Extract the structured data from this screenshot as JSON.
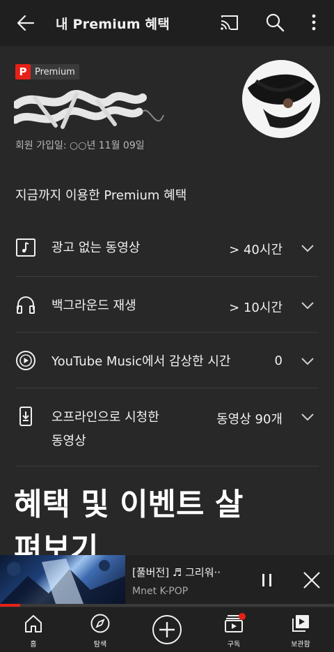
{
  "header": {
    "title": "내 Premium 혜택"
  },
  "membership": {
    "badge_letter": "P",
    "badge_label": "Premium",
    "joined_text": "회원 가입일: ○○년 11월 09일"
  },
  "benefits": {
    "section_title": "지금까지 이용한 Premium 혜택",
    "items": [
      {
        "label": "광고 없는 동영상",
        "value": "> 40시간",
        "icon": "music-note-icon"
      },
      {
        "label": "백그라운드 재생",
        "value": "> 10시간",
        "icon": "headphones-icon"
      },
      {
        "label": "YouTube Music에서 감상한 시간",
        "value": "0",
        "icon": "music-play-circle-icon"
      },
      {
        "label": "오프라인으로 시청한\n동영상",
        "value": "동영상 90개",
        "icon": "phone-download-icon"
      }
    ]
  },
  "events": {
    "title": "혜택 및 이벤트 살펴보기"
  },
  "miniplayer": {
    "title": "[풀버전] ♬ 그리워··",
    "subtitle": "Mnet K-POP",
    "progress_percent": 6
  },
  "bottom_nav": [
    {
      "label": "홈",
      "icon": "home-icon"
    },
    {
      "label": "탐색",
      "icon": "explore-icon"
    },
    {
      "label": "",
      "icon": "add-icon"
    },
    {
      "label": "구독",
      "icon": "subscriptions-icon"
    },
    {
      "label": "보관함",
      "icon": "library-icon"
    }
  ],
  "colors": {
    "accent": "#e62117",
    "background": "#282828",
    "bar": "#1f1f1f"
  }
}
